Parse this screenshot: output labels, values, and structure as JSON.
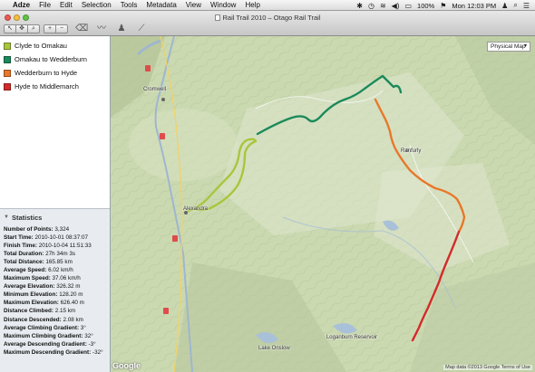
{
  "menubar": {
    "apple": "",
    "app_name": "Adze",
    "items": [
      "File",
      "Edit",
      "Selection",
      "Tools",
      "Metadata",
      "View",
      "Window",
      "Help"
    ],
    "battery": "100%",
    "clock": "Mon 12:03 PM"
  },
  "window": {
    "title": "Rail Trail 2010 – Otago Rail Trail"
  },
  "tracks": [
    {
      "name": "Clyde to Omakau",
      "color": "#a8c63c"
    },
    {
      "name": "Omakau to Wedderburn",
      "color": "#1a8a5a"
    },
    {
      "name": "Wedderburn to Hyde",
      "color": "#e8782a"
    },
    {
      "name": "Hyde to Middlemarch",
      "color": "#d42a2a"
    }
  ],
  "statistics": {
    "header": "Statistics",
    "rows": [
      {
        "label": "Number of Points:",
        "value": "3,324"
      },
      {
        "label": "Start Time:",
        "value": "2010-10-01 08:37:07"
      },
      {
        "label": "Finish Time:",
        "value": "2010-10-04 11:51:33"
      },
      {
        "label": "Total Duration:",
        "value": "27h 34m 3s"
      },
      {
        "label": "Total Distance:",
        "value": "165.85 km"
      },
      {
        "label": "Average Speed:",
        "value": "6.02 km/h"
      },
      {
        "label": "Maximum Speed:",
        "value": "37.06 km/h"
      },
      {
        "label": "Average Elevation:",
        "value": "326.32 m"
      },
      {
        "label": "Minimum Elevation:",
        "value": "128.20 m"
      },
      {
        "label": "Maximum Elevation:",
        "value": "626.40 m"
      },
      {
        "label": "Distance Climbed:",
        "value": "2.15 km"
      },
      {
        "label": "Distance Descended:",
        "value": "2.08 km"
      },
      {
        "label": "Average Climbing Gradient:",
        "value": "3°"
      },
      {
        "label": "Maximum Climbing Gradient:",
        "value": "32°"
      },
      {
        "label": "Average Descending Gradient:",
        "value": "-3°"
      },
      {
        "label": "Maximum Descending Gradient:",
        "value": "-32°"
      }
    ]
  },
  "map": {
    "type_selector": "Physical Map",
    "labels": {
      "cromwell": "Cromwell",
      "alexandra": "Alexandra",
      "ranfurly": "Ranfurly",
      "lake_onslow": "Lake Onslow",
      "loganburn": "Loganburn Reservoir"
    },
    "credit": "Map data ©2013 Google  Terms of Use",
    "logo": "Google"
  }
}
